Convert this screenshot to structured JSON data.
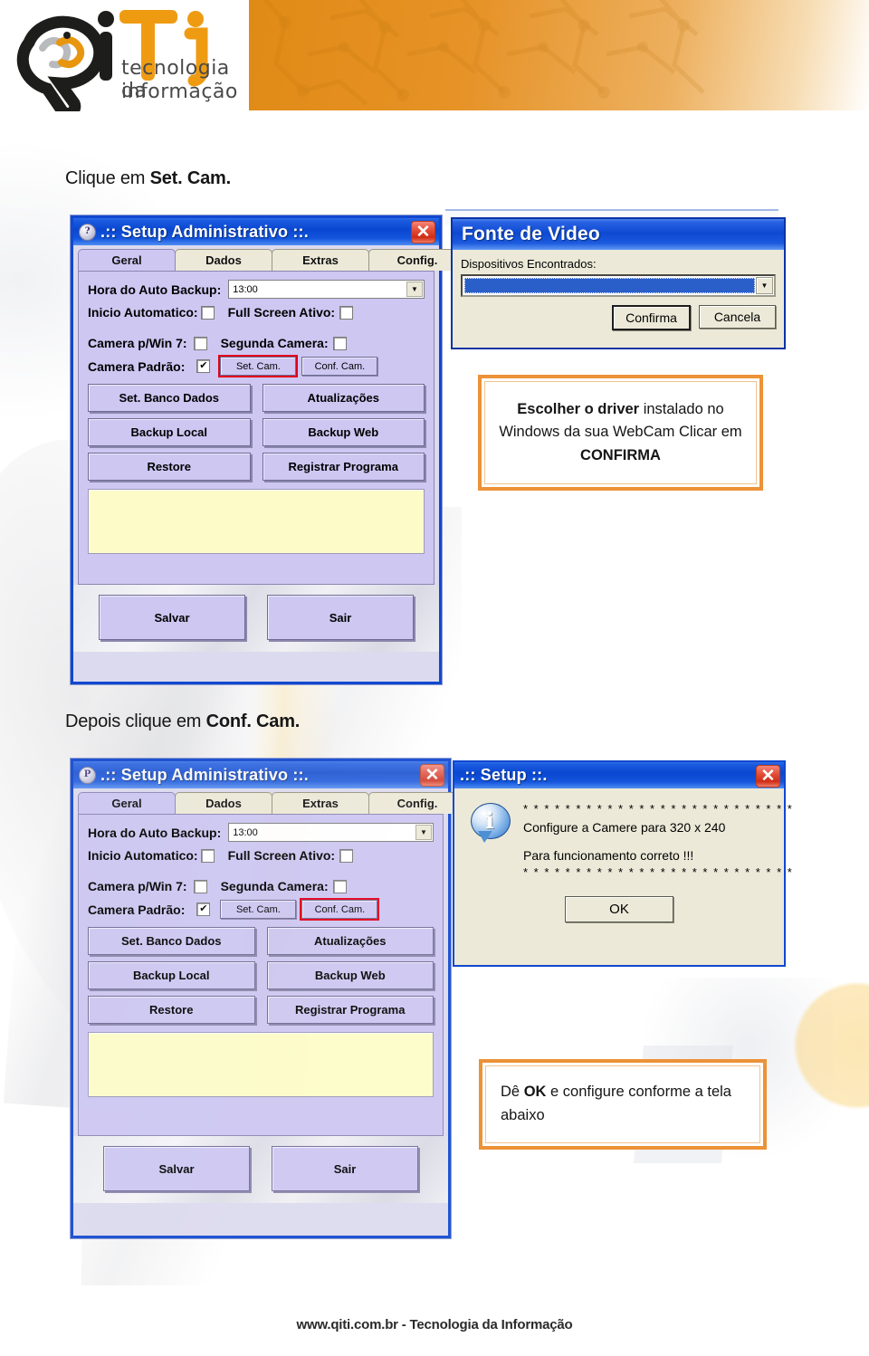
{
  "header": {
    "logo_mark": "QiTi",
    "logo_line1": "tecnologia da",
    "logo_line2": "informação"
  },
  "steps": [
    {
      "caption_plain": "Clique em ",
      "caption_bold": "Set. Cam."
    },
    {
      "caption_plain": "Depois clique em ",
      "caption_bold": "Conf. Cam."
    }
  ],
  "setup_admin": {
    "title": ".:: Setup Administrativo ::.",
    "icon": "help-question-icon",
    "close_label": "✕",
    "tabs": [
      {
        "label": "Geral",
        "active": true
      },
      {
        "label": "Dados",
        "active": false
      },
      {
        "label": "Extras",
        "active": false
      },
      {
        "label": "Config.",
        "active": false
      }
    ],
    "fields": {
      "auto_backup_label": "Hora do Auto Backup:",
      "auto_backup_value": "13:00",
      "inicio_automatico_label": "Inicio Automatico:",
      "inicio_automatico_checked": false,
      "full_screen_label": "Full Screen Ativo:",
      "full_screen_checked": false,
      "camera_win7_label": "Camera p/Win 7:",
      "camera_win7_checked": false,
      "segunda_camera_label": "Segunda Camera:",
      "segunda_camera_checked": false,
      "camera_padrao_label": "Camera Padrão:",
      "camera_padrao_checked": true,
      "camera_padrao_check_glyph": "✔",
      "set_cam_label": "Set. Cam.",
      "conf_cam_label": "Conf. Cam."
    },
    "buttons": {
      "set_banco_dados": "Set. Banco Dados",
      "atualizacoes": "Atualizações",
      "backup_local": "Backup Local",
      "backup_web": "Backup Web",
      "restore": "Restore",
      "registrar_programa": "Registrar Programa",
      "salvar": "Salvar",
      "sair": "Sair"
    },
    "memo_value": ""
  },
  "fonte_video": {
    "title": "Fonte de Video",
    "devices_label": "Dispositivos Encontrados:",
    "device_value": "",
    "confirm_label": "Confirma",
    "cancel_label": "Cancela",
    "dropdown_glyph": "▼"
  },
  "setup_msg": {
    "title": ".:: Setup ::.",
    "icon": "information-icon",
    "close_label": "✕",
    "line_stars_top": "* * * * * * * * * * * * * * * * * * * * * * * * * *",
    "line1": "Configure a Camere para 320 x 240",
    "line2": "Para funcionamento correto !!!",
    "line_stars_bottom": "* * * * * * * * * * * * * * * * * * * * * * * * * *",
    "ok_label": "OK"
  },
  "callouts": {
    "first": {
      "seg1_bold": "Escolher o driver",
      "seg2": " instalado no Windows da sua WebCam Clicar em ",
      "seg3_bold": "CONFIRMA"
    },
    "second": {
      "seg1": "Dê ",
      "seg2_bold": "OK",
      "seg3": " e configure conforme a tela abaixo"
    }
  },
  "footer": {
    "text": "www.qiti.com.br - Tecnologia da Informação"
  },
  "colors": {
    "brand_orange": "#e08a16",
    "callout_border": "#ec9237",
    "highlight_red": "#e2001a",
    "titlebar_blue": "#0a47d0",
    "panel_purple": "#cdc7f2",
    "memo_yellow": "#fdfcc8"
  }
}
